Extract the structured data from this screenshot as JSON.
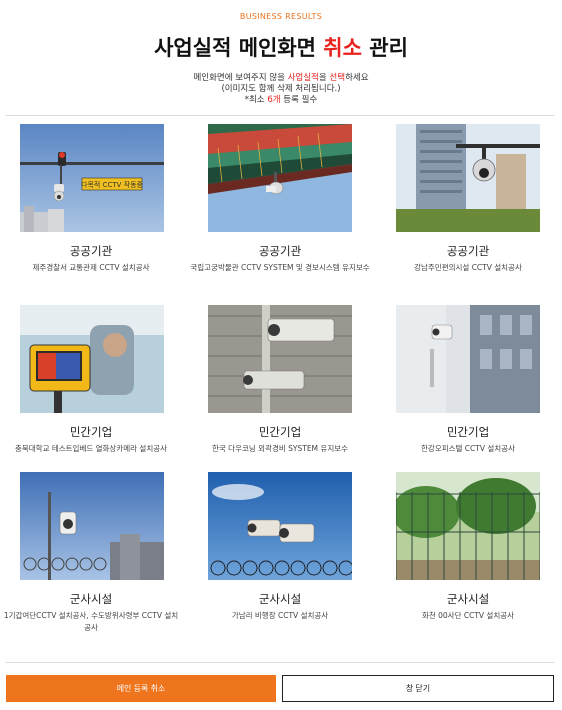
{
  "header": {
    "eyebrow": "BUSINESS RESULTS",
    "title_part1": "사업실적 메인화면 ",
    "title_highlight": "취소",
    "title_part2": " 관리",
    "notice_line1_a": "메인화면에 보여주지 않을 ",
    "notice_line1_b": "사업실적",
    "notice_line1_c": "을 ",
    "notice_line1_d": "선택",
    "notice_line1_e": "하세요",
    "notice_line2": "(이미지도 함께 삭제 처리됩니다.)",
    "notice_line3_a": "*최소 ",
    "notice_line3_b": "6개",
    "notice_line3_c": " 등록 필수"
  },
  "items": [
    {
      "category": "공공기관",
      "description": "제주경찰서 교통관제 CCTV 설치공사",
      "sign_text": "다목적 CCTV 작동중"
    },
    {
      "category": "공공기관",
      "description": "국립고궁박물관 CCTV SYSTEM 및 경보시스템 유지보수"
    },
    {
      "category": "공공기관",
      "description": "강남주민편의시설 CCTV 설치공사"
    },
    {
      "category": "민간기업",
      "description": "충북대학교 테스트입베드 열화상카메라 설치공사"
    },
    {
      "category": "민간기업",
      "description": "한국 다우코닝 외곽경비 SYSTEM 유지보수"
    },
    {
      "category": "민간기업",
      "description": "한강오피스텔 CCTV 설치공사"
    },
    {
      "category": "군사시설",
      "description": "1기갑여단CCTV 설치공사, 수도방위사령부 CCTV 설치공사"
    },
    {
      "category": "군사시설",
      "description": "가남리 비행장 CCTV 설치공사"
    },
    {
      "category": "군사시설",
      "description": "화천 00사단 CCTV 설치공사"
    }
  ],
  "buttons": {
    "cancel_main": "메인 등록 취소",
    "close": "창 닫기"
  },
  "colors": {
    "accent_orange": "#ee741e",
    "highlight_red": "#e8231f"
  }
}
